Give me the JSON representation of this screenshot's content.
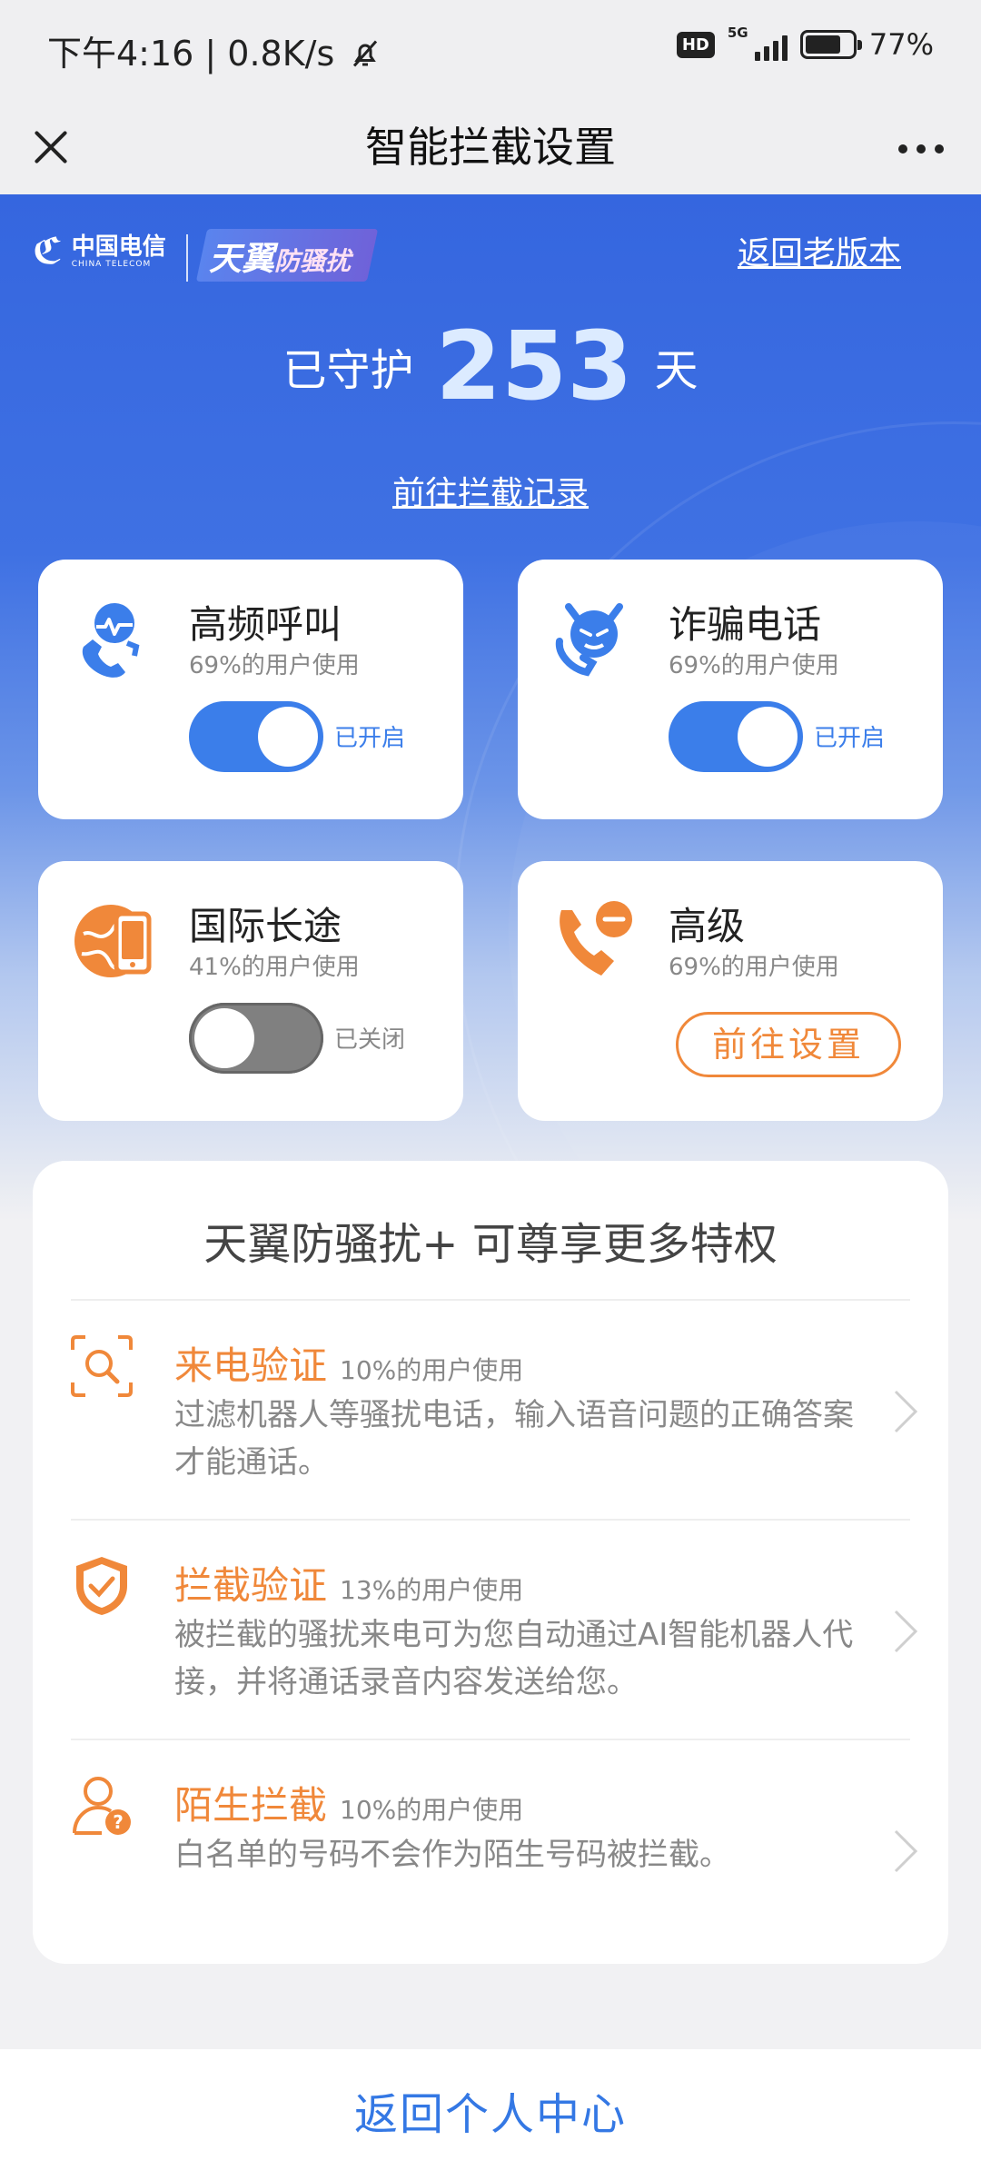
{
  "status_bar": {
    "time": "下午4:16 | 0.8K/s",
    "hd": "HD",
    "network": "5G",
    "battery": "77%",
    "battery_level": 0.77
  },
  "nav": {
    "title": "智能拦截设置"
  },
  "hero": {
    "logo_cn": "中国电信",
    "logo_en": "CHINA TELECOM",
    "brand_a": "天翼",
    "brand_b": "防骚扰",
    "old_version_link": "返回老版本",
    "guard_prefix": "已守护",
    "guard_days": "253",
    "guard_suffix": "天",
    "records_link": "前往拦截记录"
  },
  "cards": [
    {
      "title": "高频呼叫",
      "usage": "69%的用户使用",
      "state_label": "已开启",
      "enabled": true
    },
    {
      "title": "诈骗电话",
      "usage": "69%的用户使用",
      "state_label": "已开启",
      "enabled": true
    },
    {
      "title": "国际长途",
      "usage": "41%的用户使用",
      "state_label": "已关闭",
      "enabled": false
    },
    {
      "title": "高级",
      "usage": "69%的用户使用",
      "action_label": "前往设置"
    }
  ],
  "privileges": {
    "title": "天翼防骚扰+ 可尊享更多特权",
    "items": [
      {
        "name": "来电验证",
        "usage": "10%的用户使用",
        "desc": "过滤机器人等骚扰电话，输入语音问题的正确答案才能通话。"
      },
      {
        "name": "拦截验证",
        "usage": "13%的用户使用",
        "desc": "被拦截的骚扰来电可为您自动通过AI智能机器人代接，并将通话录音内容发送给您。"
      },
      {
        "name": "陌生拦截",
        "usage": "10%的用户使用",
        "desc": "白名单的号码不会作为陌生号码被拦截。"
      }
    ]
  },
  "footer": {
    "label": "返回个人中心"
  },
  "colors": {
    "accent_blue": "#3b7eea",
    "accent_orange": "#f0883a",
    "hero_blue": "#3566df"
  }
}
